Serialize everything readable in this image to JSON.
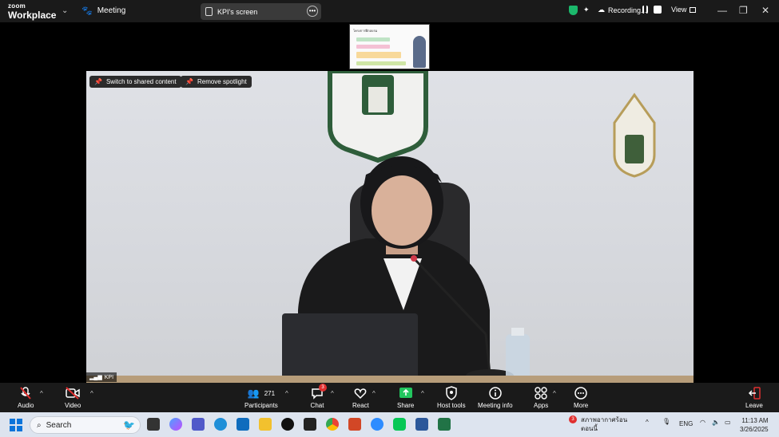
{
  "titlebar": {
    "logo_top": "zoom",
    "logo_bottom": "Workplace",
    "meeting_label": "Meeting",
    "screen_label": "KPI's screen",
    "recording_label": "Recording...",
    "view_label": "View"
  },
  "thumbnail": {
    "title": "โครงการฝึกอบรม"
  },
  "video": {
    "switch_label": "Switch to shared content",
    "remove_label": "Remove spotlight",
    "name_tag": "KPI"
  },
  "toolbar": {
    "audio": "Audio",
    "video": "Video",
    "participants": "Participants",
    "participants_count": "271",
    "chat": "Chat",
    "chat_badge": "3",
    "react": "React",
    "share": "Share",
    "host_tools": "Host tools",
    "meeting_info": "Meeting info",
    "apps": "Apps",
    "more": "More",
    "leave": "Leave"
  },
  "taskbar": {
    "search_placeholder": "Search",
    "weather_line1": "สภาพอากาศร้อน",
    "weather_line2": "ตอนนี้",
    "weather_badge": "3",
    "lang": "ENG",
    "time": "11:13 AM",
    "date": "3/26/2025"
  },
  "colors": {
    "accent_green": "#1bb86b",
    "share_green": "#22c55e",
    "danger_red": "#e02f2f"
  }
}
